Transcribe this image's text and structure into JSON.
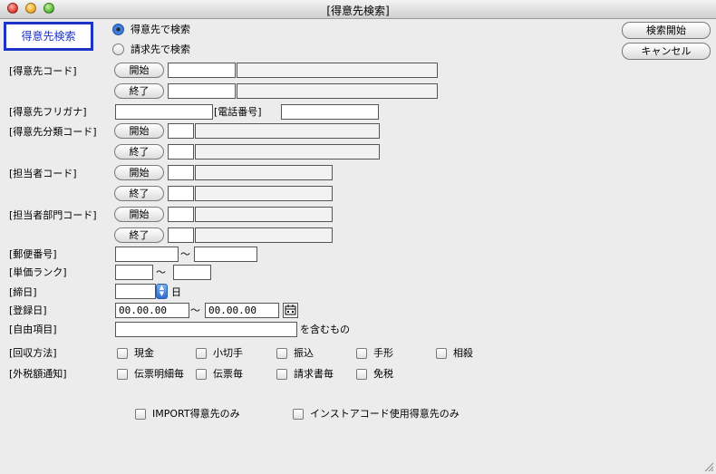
{
  "window": {
    "title": "[得意先検索]"
  },
  "tab": {
    "label": "得意先検索"
  },
  "search_mode": {
    "option1": "得意先で検索",
    "option2": "請求先で検索",
    "selected": 1
  },
  "actions": {
    "search": "検索開始",
    "cancel": "キャンセル"
  },
  "buttons": {
    "start": "開始",
    "end": "終了"
  },
  "fields": {
    "customer_code": "[得意先コード]",
    "furigana": "[得意先フリガナ]",
    "phone": "[電話番号]",
    "category_code": "[得意先分類コード]",
    "staff_code": "[担当者コード]",
    "staff_dept_code": "[担当者部門コード]",
    "postal_code": "[郵便番号]",
    "price_rank": "[単価ランク]",
    "closing_day": "[締日]",
    "closing_unit": "日",
    "registration_date": "[登録日]",
    "date_from": "00.00.00",
    "date_to": "00.00.00",
    "free_item": "[自由項目]",
    "contains": "を含むもの",
    "tilde": "〜"
  },
  "collection": {
    "label": "[回収方法]",
    "options": [
      "現金",
      "小切手",
      "振込",
      "手形",
      "相殺"
    ]
  },
  "tax_notice": {
    "label": "[外税額通知]",
    "options": [
      "伝票明細毎",
      "伝票毎",
      "請求書毎",
      "免税"
    ]
  },
  "filters": {
    "import_only": "IMPORT得意先のみ",
    "instore_only": "インストアコード使用得意先のみ"
  },
  "colors": {
    "tab_border": "#1d33c8",
    "accent": "#2f6cd0"
  }
}
